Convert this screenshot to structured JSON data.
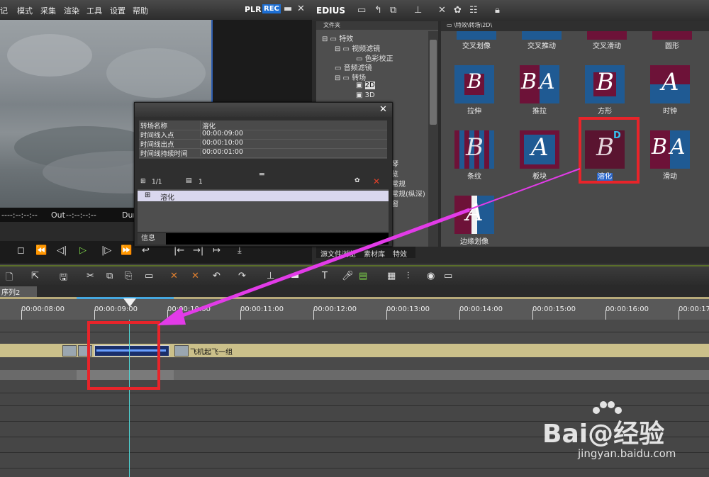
{
  "menu": {
    "items": [
      "记",
      "模式",
      "采集",
      "渲染",
      "工具",
      "设置",
      "帮助"
    ],
    "plr": "PLR",
    "rec": "REC",
    "minimize": "▬",
    "close": "✕"
  },
  "preview": {
    "tc_in": "----:--:--:--",
    "out_label": "Out",
    "tc_out": "--:--:--:--",
    "dur_label": "Dur"
  },
  "effects": {
    "app_name": "EDIUS",
    "tree_header": "文件夹",
    "tree": [
      "特效",
      "视频滤镜",
      "色彩校正",
      "音频滤镜",
      "转场",
      "2D",
      "3D"
    ],
    "tree_partial": [
      "琴",
      "览",
      "常规",
      "常规(纵深)",
      "窗"
    ],
    "grid_path": "\\特效\\转场\\2D\\",
    "items": [
      {
        "label": "交叉划像"
      },
      {
        "label": "交叉推动"
      },
      {
        "label": "交叉滑动"
      },
      {
        "label": "圆形"
      },
      {
        "label": "拉伸",
        "letter": "B"
      },
      {
        "label": "推拉",
        "letter": "BA"
      },
      {
        "label": "方形",
        "letter": "B"
      },
      {
        "label": "时钟",
        "letter": "A"
      },
      {
        "label": "条纹",
        "letter": "B"
      },
      {
        "label": "板块",
        "letter": "A"
      },
      {
        "label": "溶化",
        "letter": "B",
        "badge": "D"
      },
      {
        "label": "滑动",
        "letter": "BA"
      },
      {
        "label": "边缘划像",
        "letter": "A"
      }
    ],
    "tabs": [
      "源文件浏览",
      "素材库",
      "特效"
    ]
  },
  "dialog": {
    "close": "✕",
    "rows": [
      {
        "key": "转场名称",
        "value": "溶化"
      },
      {
        "key": "时间线入点",
        "value": "00:00:09:00"
      },
      {
        "key": "时间线出点",
        "value": "00:00:10:00"
      },
      {
        "key": "时间线持续时间",
        "value": "00:00:01:00"
      }
    ],
    "page": "1/1",
    "layer": "1",
    "list_item": "溶化",
    "info_label": "信息"
  },
  "timeline": {
    "sequence_tab": "序列2",
    "ruler_labels": [
      "00:00:08:00",
      "00:00:09:00",
      "00:00:10:00",
      "00:00:11:00",
      "00:00:12:00",
      "00:00:13:00",
      "00:00:14:00",
      "00:00:15:00",
      "00:00:16:00",
      "00:00:17"
    ],
    "clip_name": "飞机起飞一组"
  },
  "watermark": {
    "main": "Bai@经验",
    "sub": "jingyan.baidu.com"
  },
  "colors": {
    "annotation_red": "#e8242a",
    "arrow_magenta": "#e23be8",
    "playhead": "#4fd6d6",
    "clip": "#cbc08a",
    "thumb_blue": "#1f5a93",
    "thumb_maroon": "#6d1238"
  }
}
